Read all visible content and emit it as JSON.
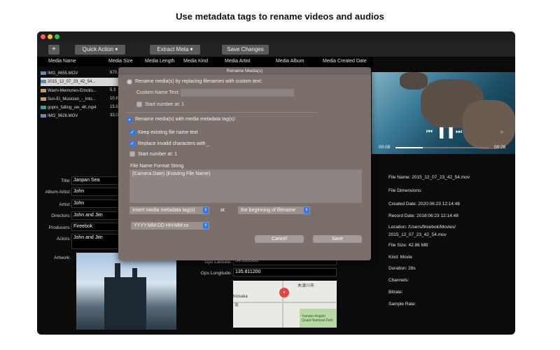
{
  "headline": "Use metadata tags to rename videos and audios",
  "toolbar": {
    "add": "+",
    "quick_action": "Quick Action ▾",
    "extract_meta": "Extract Meta ▾",
    "save_changes": "Save Changes"
  },
  "columns": [
    "Media Name",
    "Media Size",
    "Media Length",
    "Media Kind",
    "Media Artist",
    "Media Album",
    "Media Created Date"
  ],
  "files": [
    {
      "name": "IMG_8655.MOV",
      "size": "670."
    },
    {
      "name": "2015_12_07_23_42_54...",
      "size": "9.5"
    },
    {
      "name": "Warm-Memories-Emotio...",
      "size": "5.3"
    },
    {
      "name": "Sun-El_Musician_-_Into...",
      "size": "10.6"
    },
    {
      "name": "gopro_falling_uw_4K.mp4",
      "size": "15.6"
    },
    {
      "name": "IMG_9626.MOV",
      "size": "33.0"
    }
  ],
  "player": {
    "current": "00:08",
    "total": "00:28",
    "progress": 0.29
  },
  "info": {
    "file_name": "File Name: 2015_12_07_23_42_54.mov",
    "dimensions": "File Dimensions:",
    "created": "Created Date: 2020:06:23 12:14:48",
    "record": "Record Date: 2018:06:23 12:14:48",
    "location1": "Location: /Users/fireebok/Movies/",
    "location2": "2015_12_07_23_42_54.mov",
    "file_size": "File Size: 42.86 MB",
    "kind": "Kind: Movie",
    "duration": "Duration: 28s",
    "channels": "Channels:",
    "bitrate": "Bitrate:",
    "sample_rate": "Sample Rate:"
  },
  "meta": {
    "title_label": "Title:",
    "title": "Janpan Sea",
    "album_artist_label": "Album Artist:",
    "album_artist": "John",
    "artist_label": "Artist:",
    "artist": "John",
    "directors_label": "Directors:",
    "directors": "John and Jim",
    "producers_label": "Producers:",
    "producers": "Fireebok",
    "actors_label": "Actors:",
    "actors": "John and Jim",
    "artwork_label": "Artwork:",
    "gps_lat_label": "Gps Latitude:",
    "gps_lat": "34.685500",
    "gps_lon_label": "Gps Longitude:",
    "gps_lon": "135.811200"
  },
  "map": {
    "place1": "木津川市",
    "place2": "hiosaka",
    "place3": "市",
    "park": "Yamato-Aogaki Quasi-National Park"
  },
  "modal": {
    "title": "Rename Media(s)",
    "opt_custom": "Rename media(s) by replacing filenames with custom text:",
    "custom_label": "Custom Name Text:",
    "start_number_1": "Start number at: 1",
    "opt_metadata": "Rename media(s) with media metadata tag(s):",
    "keep_existing": "Keep existing file name text",
    "replace_invalid": "Replace invalid characters with _",
    "start_number_2": "Start number at: 1",
    "format_label": "File Name Format String",
    "format_value": "{Camera Date} {Existing File Name}",
    "insert_tag": "Insert media metadata tag(s)",
    "at": "at",
    "position": "the beginning of filename",
    "date_format": "YYYY:MM:DD HH:MM:ss",
    "cancel": "Cancel",
    "save": "Save"
  },
  "colors": {
    "accent": "#2f7ce8",
    "modal_bg": "#7a6f6b",
    "map_pin": "#e04646"
  }
}
